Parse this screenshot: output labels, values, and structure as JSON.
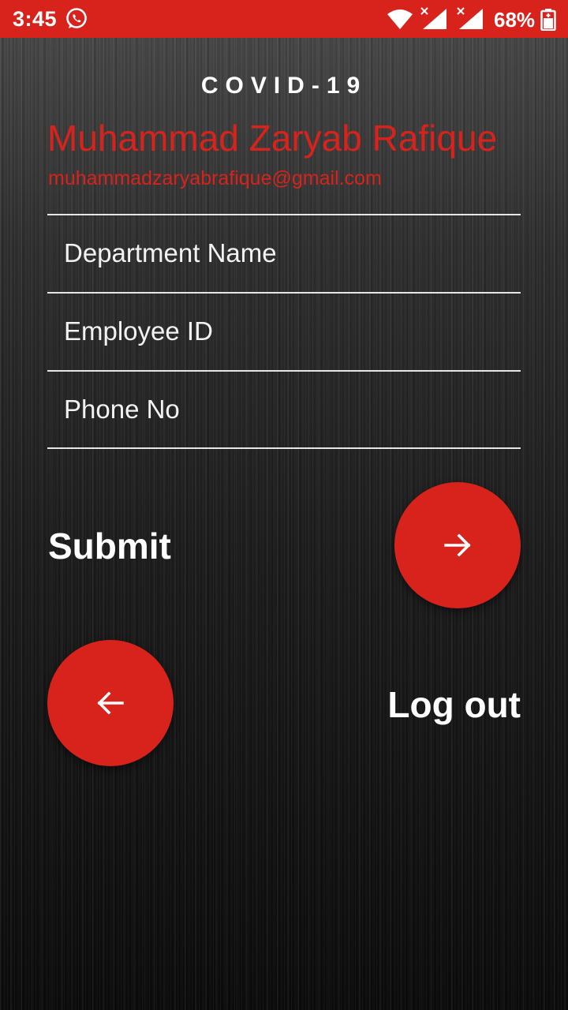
{
  "status_bar": {
    "time": "3:45",
    "battery": "68%",
    "icons": [
      "whatsapp-icon",
      "wifi-icon",
      "signal-icon",
      "signal-icon",
      "battery-icon"
    ]
  },
  "header": {
    "title": "COVID-19",
    "user_name": "Muhammad Zaryab Rafique",
    "user_email": "muhammadzaryabrafique@gmail.com"
  },
  "form": {
    "department_placeholder": "Department Name",
    "department_value": "",
    "employee_id_placeholder": "Employee ID",
    "employee_id_value": "",
    "phone_placeholder": "Phone No",
    "phone_value": ""
  },
  "actions": {
    "submit_label": "Submit",
    "submit_icon": "arrow-right-icon",
    "logout_label": "Log out",
    "logout_icon": "arrow-left-icon"
  },
  "colors": {
    "accent": "#d8231d",
    "text": "#ffffff",
    "background": "#1a1a1a"
  }
}
